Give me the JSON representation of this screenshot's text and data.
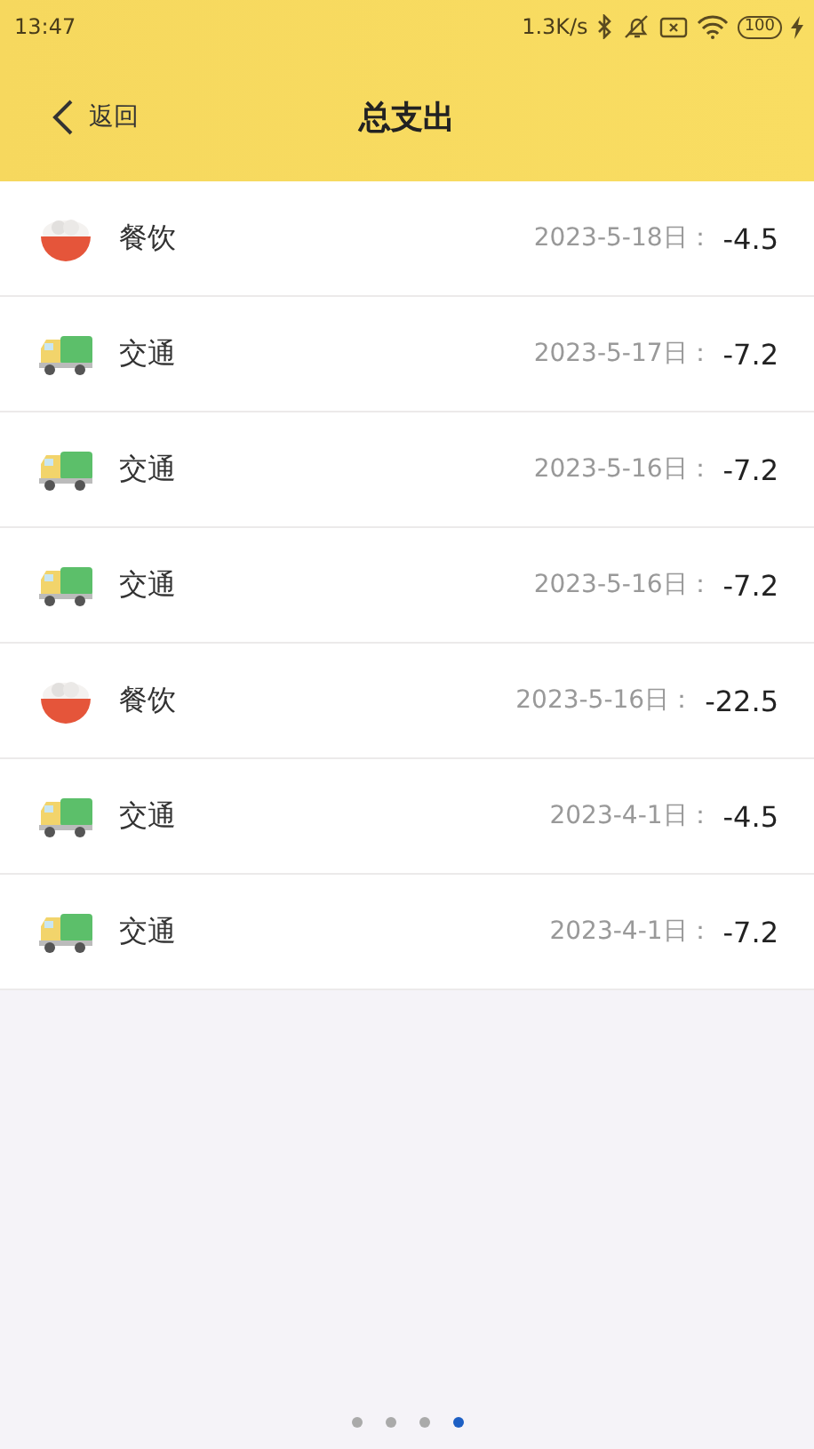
{
  "status_bar": {
    "time": "13:47",
    "speed": "1.3K/s",
    "battery": "100"
  },
  "header": {
    "back_label": "返回",
    "title": "总支出"
  },
  "records": [
    {
      "kind": "food",
      "category": "餐饮",
      "date": "2023-5-18日：",
      "amount": "-4.5"
    },
    {
      "kind": "transport",
      "category": "交通",
      "date": "2023-5-17日：",
      "amount": "-7.2"
    },
    {
      "kind": "transport",
      "category": "交通",
      "date": "2023-5-16日：",
      "amount": "-7.2"
    },
    {
      "kind": "transport",
      "category": "交通",
      "date": "2023-5-16日：",
      "amount": "-7.2"
    },
    {
      "kind": "food",
      "category": "餐饮",
      "date": "2023-5-16日：",
      "amount": "-22.5"
    },
    {
      "kind": "transport",
      "category": "交通",
      "date": "2023-4-1日：",
      "amount": "-4.5"
    },
    {
      "kind": "transport",
      "category": "交通",
      "date": "2023-4-1日：",
      "amount": "-7.2"
    }
  ],
  "page_dots": [
    {
      "selected": false
    },
    {
      "selected": false
    },
    {
      "selected": false
    },
    {
      "selected": true
    }
  ]
}
